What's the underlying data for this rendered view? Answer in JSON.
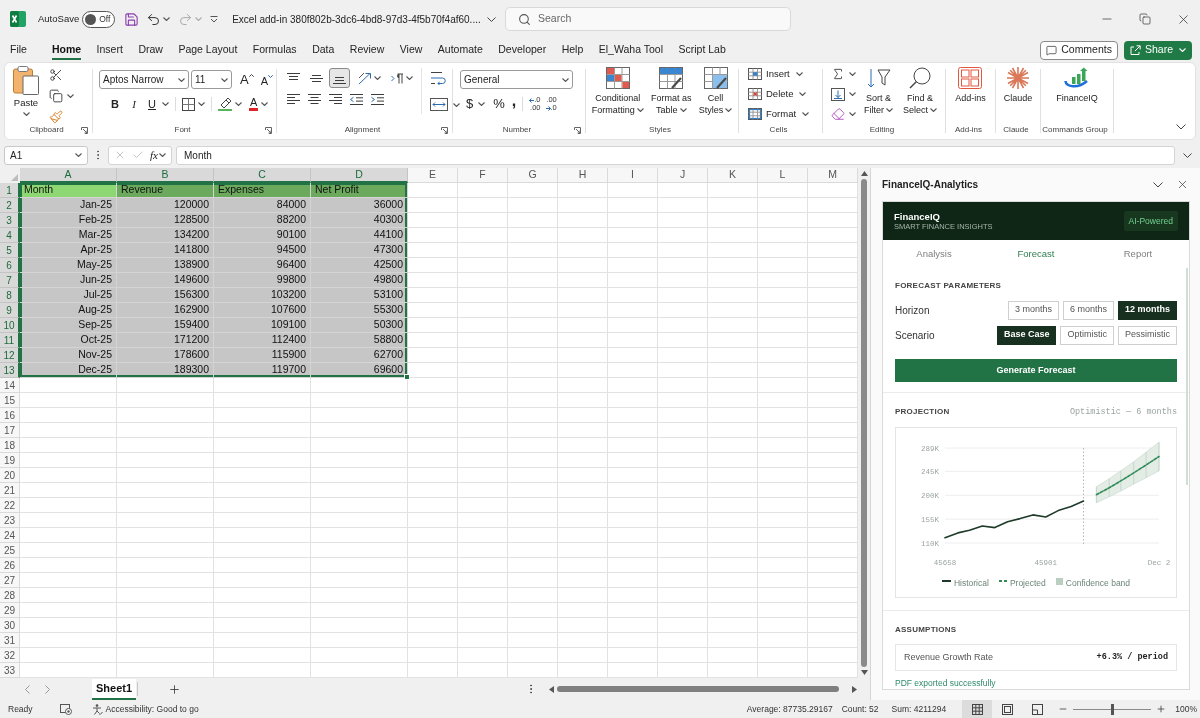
{
  "title_bar": {
    "autosave_label": "AutoSave",
    "autosave": {
      "on": false,
      "label": "Off"
    },
    "document_title": "Excel add-in 380f802b-3dc6-4bd8-97d3-4f5b70f4af60....",
    "search": {
      "placeholder": "Search"
    }
  },
  "menu_tabs": [
    {
      "label": "File",
      "selected": false
    },
    {
      "label": "Home",
      "selected": true
    },
    {
      "label": "Insert",
      "selected": false
    },
    {
      "label": "Draw",
      "selected": false
    },
    {
      "label": "Page Layout",
      "selected": false
    },
    {
      "label": "Formulas",
      "selected": false
    },
    {
      "label": "Data",
      "selected": false
    },
    {
      "label": "Review",
      "selected": false
    },
    {
      "label": "View",
      "selected": false
    },
    {
      "label": "Automate",
      "selected": false
    },
    {
      "label": "Developer",
      "selected": false
    },
    {
      "label": "Help",
      "selected": false
    },
    {
      "label": "El_Waha Tool",
      "selected": false
    },
    {
      "label": "Script Lab",
      "selected": false
    }
  ],
  "comments_button": "Comments",
  "share_button": "Share",
  "ribbon": {
    "clipboard": {
      "label": "Clipboard",
      "paste": "Paste"
    },
    "font": {
      "label": "Font",
      "font_name": "Aptos Narrow",
      "font_size": "11",
      "grow": "A",
      "shrink": "A",
      "bold": "B",
      "italic": "I",
      "underline": "U",
      "font_color": "A"
    },
    "alignment": {
      "label": "Alignment",
      "vertical_align": [
        {
          "selected": false
        },
        {
          "selected": false
        },
        {
          "selected": true
        }
      ]
    },
    "number": {
      "label": "Number",
      "format": "General",
      "currency": "$",
      "percent": "%",
      "comma": ",",
      "decimals": [
        {
          "top": ".0",
          "bottom": ".00"
        },
        {
          "top": ".00",
          "bottom": ".0"
        }
      ]
    },
    "styles": {
      "label": "Styles",
      "buttons": [
        {
          "lines": [
            "Conditional",
            "Formatting"
          ]
        },
        {
          "lines": [
            "Format as",
            "Table"
          ]
        },
        {
          "lines": [
            "Cell",
            "Styles"
          ]
        }
      ]
    },
    "cells": {
      "label": "Cells",
      "buttons": [
        "Insert",
        "Delete",
        "Format"
      ]
    },
    "editing": {
      "label": "Editing",
      "buttons": [
        {
          "lines": [
            "Sort &",
            "Filter"
          ]
        },
        {
          "lines": [
            "Find &",
            "Select"
          ]
        }
      ]
    },
    "add_ins": {
      "label": "Add-ins",
      "button": "Add-ins"
    },
    "claude": {
      "label": "Claude",
      "button": "Claude"
    },
    "commands": {
      "label": "Commands Group",
      "button": "FinanceIQ"
    }
  },
  "formula_bar": {
    "name_box": "A1",
    "function_label": "fx",
    "formula": "Month"
  },
  "sheet": {
    "columns": [
      {
        "label": "A",
        "selected": true
      },
      {
        "label": "B",
        "selected": true
      },
      {
        "label": "C",
        "selected": true
      },
      {
        "label": "D",
        "selected": true
      },
      {
        "label": "E",
        "selected": false
      },
      {
        "label": "F",
        "selected": false
      },
      {
        "label": "G",
        "selected": false
      },
      {
        "label": "H",
        "selected": false
      },
      {
        "label": "I",
        "selected": false
      },
      {
        "label": "J",
        "selected": false
      },
      {
        "label": "K",
        "selected": false
      },
      {
        "label": "L",
        "selected": false
      },
      {
        "label": "M",
        "selected": false
      }
    ],
    "row_numbers": [
      {
        "label": "1",
        "selected": true
      },
      {
        "label": "2",
        "selected": true
      },
      {
        "label": "3",
        "selected": true
      },
      {
        "label": "4",
        "selected": true
      },
      {
        "label": "5",
        "selected": true
      },
      {
        "label": "6",
        "selected": true
      },
      {
        "label": "7",
        "selected": true
      },
      {
        "label": "8",
        "selected": true
      },
      {
        "label": "9",
        "selected": true
      },
      {
        "label": "10",
        "selected": true
      },
      {
        "label": "11",
        "selected": true
      },
      {
        "label": "12",
        "selected": true
      },
      {
        "label": "13",
        "selected": true
      },
      {
        "label": "14",
        "selected": false
      },
      {
        "label": "15",
        "selected": false
      },
      {
        "label": "16",
        "selected": false
      },
      {
        "label": "17",
        "selected": false
      },
      {
        "label": "18",
        "selected": false
      },
      {
        "label": "19",
        "selected": false
      },
      {
        "label": "20",
        "selected": false
      },
      {
        "label": "21",
        "selected": false
      },
      {
        "label": "22",
        "selected": false
      },
      {
        "label": "23",
        "selected": false
      },
      {
        "label": "24",
        "selected": false
      },
      {
        "label": "25",
        "selected": false
      },
      {
        "label": "26",
        "selected": false
      },
      {
        "label": "27",
        "selected": false
      },
      {
        "label": "28",
        "selected": false
      },
      {
        "label": "29",
        "selected": false
      },
      {
        "label": "30",
        "selected": false
      },
      {
        "label": "31",
        "selected": false
      },
      {
        "label": "32",
        "selected": false
      },
      {
        "label": "33",
        "selected": false
      }
    ],
    "rows": [
      {
        "kind": "header",
        "selected": true,
        "cells": [
          {
            "text": "Month",
            "active": true
          },
          {
            "text": "Revenue",
            "active": false
          },
          {
            "text": "Expenses",
            "active": false
          },
          {
            "text": "Net Profit",
            "active": false
          }
        ]
      },
      {
        "kind": "data",
        "selected": true,
        "cells": [
          {
            "text": "Jan-25",
            "active": false
          },
          {
            "text": "120000",
            "active": false
          },
          {
            "text": "84000",
            "active": false
          },
          {
            "text": "36000",
            "active": false
          }
        ]
      },
      {
        "kind": "data",
        "selected": true,
        "cells": [
          {
            "text": "Feb-25",
            "active": false
          },
          {
            "text": "128500",
            "active": false
          },
          {
            "text": "88200",
            "active": false
          },
          {
            "text": "40300",
            "active": false
          }
        ]
      },
      {
        "kind": "data",
        "selected": true,
        "cells": [
          {
            "text": "Mar-25",
            "active": false
          },
          {
            "text": "134200",
            "active": false
          },
          {
            "text": "90100",
            "active": false
          },
          {
            "text": "44100",
            "active": false
          }
        ]
      },
      {
        "kind": "data",
        "selected": true,
        "cells": [
          {
            "text": "Apr-25",
            "active": false
          },
          {
            "text": "141800",
            "active": false
          },
          {
            "text": "94500",
            "active": false
          },
          {
            "text": "47300",
            "active": false
          }
        ]
      },
      {
        "kind": "data",
        "selected": true,
        "cells": [
          {
            "text": "May-25",
            "active": false
          },
          {
            "text": "138900",
            "active": false
          },
          {
            "text": "96400",
            "active": false
          },
          {
            "text": "42500",
            "active": false
          }
        ]
      },
      {
        "kind": "data",
        "selected": true,
        "cells": [
          {
            "text": "Jun-25",
            "active": false
          },
          {
            "text": "149600",
            "active": false
          },
          {
            "text": "99800",
            "active": false
          },
          {
            "text": "49800",
            "active": false
          }
        ]
      },
      {
        "kind": "data",
        "selected": true,
        "cells": [
          {
            "text": "Jul-25",
            "active": false
          },
          {
            "text": "156300",
            "active": false
          },
          {
            "text": "103200",
            "active": false
          },
          {
            "text": "53100",
            "active": false
          }
        ]
      },
      {
        "kind": "data",
        "selected": true,
        "cells": [
          {
            "text": "Aug-25",
            "active": false
          },
          {
            "text": "162900",
            "active": false
          },
          {
            "text": "107600",
            "active": false
          },
          {
            "text": "55300",
            "active": false
          }
        ]
      },
      {
        "kind": "data",
        "selected": true,
        "cells": [
          {
            "text": "Sep-25",
            "active": false
          },
          {
            "text": "159400",
            "active": false
          },
          {
            "text": "109100",
            "active": false
          },
          {
            "text": "50300",
            "active": false
          }
        ]
      },
      {
        "kind": "data",
        "selected": true,
        "cells": [
          {
            "text": "Oct-25",
            "active": false
          },
          {
            "text": "171200",
            "active": false
          },
          {
            "text": "112400",
            "active": false
          },
          {
            "text": "58800",
            "active": false
          }
        ]
      },
      {
        "kind": "data",
        "selected": true,
        "cells": [
          {
            "text": "Nov-25",
            "active": false
          },
          {
            "text": "178600",
            "active": false
          },
          {
            "text": "115900",
            "active": false
          },
          {
            "text": "62700",
            "active": false
          }
        ]
      },
      {
        "kind": "data",
        "selected": true,
        "cells": [
          {
            "text": "Dec-25",
            "active": false
          },
          {
            "text": "189300",
            "active": false
          },
          {
            "text": "119700",
            "active": false
          },
          {
            "text": "69600",
            "active": false
          }
        ]
      }
    ]
  },
  "sheet_tabs": [
    {
      "label": "Sheet1",
      "selected": true
    }
  ],
  "task_pane": {
    "title": "FinanceIQ-Analytics",
    "header": {
      "name": "FinanceIQ",
      "tagline": "SMART FINANCE INSIGHTS",
      "badge": "AI-Powered"
    },
    "tabs": [
      {
        "label": "Analysis",
        "selected": false
      },
      {
        "label": "Forecast",
        "selected": true
      },
      {
        "label": "Report",
        "selected": false
      }
    ],
    "parameters": {
      "heading": "FORECAST PARAMETERS",
      "groups": [
        {
          "label": "Horizon",
          "options": [
            {
              "label": "3 months",
              "selected": false
            },
            {
              "label": "6 months",
              "selected": false
            },
            {
              "label": "12 months",
              "selected": true
            }
          ]
        },
        {
          "label": "Scenario",
          "options": [
            {
              "label": "Base Case",
              "selected": true
            },
            {
              "label": "Optimistic",
              "selected": false
            },
            {
              "label": "Pessimistic",
              "selected": false
            }
          ]
        }
      ]
    },
    "generate_button": "Generate Forecast",
    "projection": {
      "heading": "PROJECTION",
      "subtitle": "Optimistic — 6 months",
      "band_label": "Confidence band",
      "chart_data": {
        "type": "line",
        "x": [
          45658,
          45689,
          45717,
          45748,
          45778,
          45809,
          45839,
          45870,
          45901,
          45931,
          45962,
          45992,
          46023,
          46054,
          46082,
          46113,
          46143,
          46174
        ],
        "series": [
          {
            "name": "Historical",
            "color": "#1e3b2a",
            "values": [
              120000,
              129000,
              134000,
              142000,
              139000,
              150000,
              156000,
              163000,
              159000,
              171000,
              179000,
              189000,
              null,
              null,
              null,
              null,
              null,
              null
            ]
          },
          {
            "name": "Projected",
            "color": "#2e8a57",
            "line_style": "dashed",
            "values": [
              null,
              null,
              null,
              null,
              null,
              null,
              null,
              null,
              null,
              null,
              null,
              null,
              201000,
              214000,
              227000,
              242000,
              257000,
              273000
            ],
            "errors": [
              null,
              null,
              null,
              null,
              null,
              null,
              null,
              null,
              null,
              null,
              null,
              null,
              15000,
              17000,
              19000,
              21000,
              24000,
              27000
            ]
          }
        ],
        "ref_lines": [
          {
            "axis": "x",
            "value": 45992
          }
        ],
        "xlim": [
          45658,
          46174
        ],
        "ylim": [
          110000,
          289000
        ],
        "xticks": [
          45658,
          45901,
          {
            "value": 46174,
            "label": "Dec 2"
          }
        ],
        "yticks": [
          {
            "value": 110000,
            "label": "110K"
          },
          {
            "value": 155000,
            "label": "155K"
          },
          {
            "value": 200000,
            "label": "200K"
          },
          {
            "value": 245000,
            "label": "245K"
          },
          {
            "value": 289000,
            "label": "289K"
          }
        ],
        "grid": true,
        "legend": "bottom"
      }
    },
    "assumptions": {
      "heading": "ASSUMPTIONS",
      "rows": [
        {
          "label": "Revenue Growth Rate",
          "value": "+6.3% / period"
        }
      ]
    },
    "status_message": "PDF exported successfully"
  },
  "status_bar": {
    "mode": "Ready",
    "accessibility": "Accessibility: Good to go",
    "average": "Average: 87735.29167",
    "count": "Count: 52",
    "sum": "Sum: 4211294",
    "views": [
      {
        "selected": true
      },
      {
        "selected": false
      },
      {
        "selected": false
      }
    ],
    "zoom": {
      "level": 0.5,
      "label": "100%"
    }
  }
}
